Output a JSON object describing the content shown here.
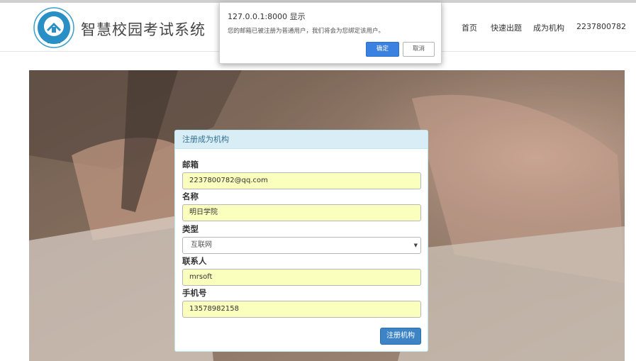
{
  "navbar": {
    "brand": "智慧校园考试系统",
    "links": [
      "首页",
      "快速出题",
      "成为机构",
      "2237800782"
    ]
  },
  "dialog": {
    "title": "127.0.0.1:8000 显示",
    "message": "您的邮箱已被注册为普通用户，我们将会为您绑定该用户。",
    "ok_label": "确定",
    "cancel_label": "取消"
  },
  "form": {
    "heading": "注册成为机构",
    "email_label": "邮箱",
    "email_value": "2237800782@qq.com",
    "name_label": "名称",
    "name_value": "明日学院",
    "type_label": "类型",
    "type_value": "互联网",
    "contact_label": "联系人",
    "contact_value": "mrsoft",
    "phone_label": "手机号",
    "phone_value": "13578982158",
    "submit_label": "注册机构"
  },
  "colors": {
    "panel_heading_bg": "#d9edf7",
    "autofill_bg": "#faffbd",
    "primary": "#3c84c6"
  }
}
